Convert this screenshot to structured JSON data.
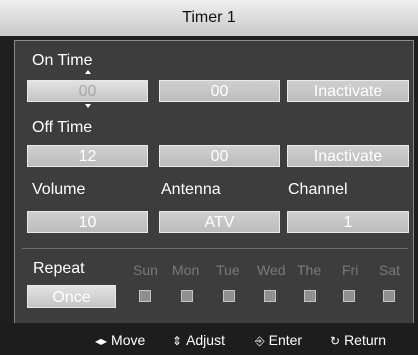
{
  "title": "Timer 1",
  "on_time": {
    "label": "On Time",
    "hour": "00",
    "minute": "00",
    "status": "Inactivate"
  },
  "off_time": {
    "label": "Off Time",
    "hour": "12",
    "minute": "00",
    "status": "Inactivate"
  },
  "settings": {
    "volume_label": "Volume",
    "volume": "10",
    "antenna_label": "Antenna",
    "antenna": "ATV",
    "channel_label": "Channel",
    "channel": "1"
  },
  "repeat": {
    "label": "Repeat",
    "value": "Once",
    "days": [
      "Sun",
      "Mon",
      "Tue",
      "Wed",
      "The",
      "Fri",
      "Sat"
    ]
  },
  "footer": {
    "move": "Move",
    "adjust": "Adjust",
    "enter": "Enter",
    "return": "Return"
  },
  "icons": {
    "move": "left-right-arrow-icon",
    "adjust": "up-down-arrow-icon",
    "enter": "enter-icon",
    "return": "return-icon"
  }
}
